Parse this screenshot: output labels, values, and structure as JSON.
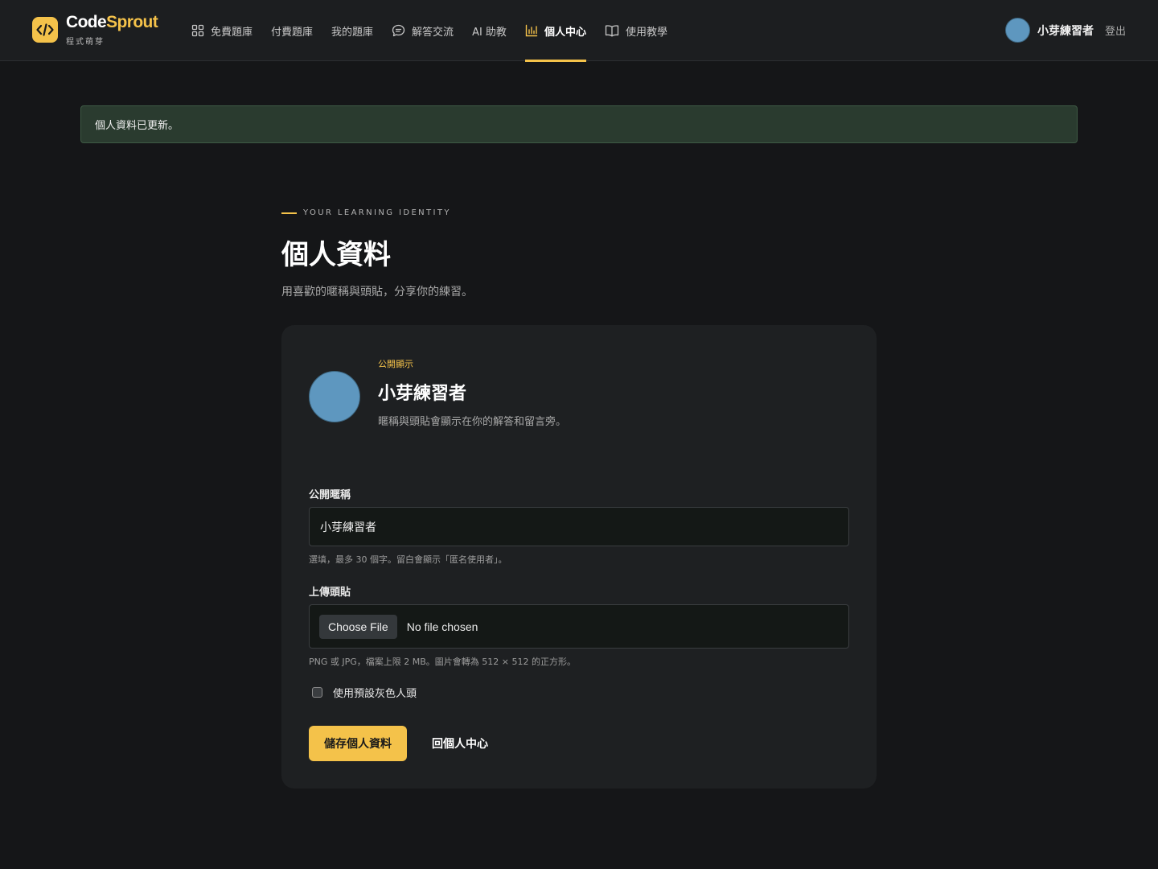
{
  "brand": {
    "name_main": "Code",
    "name_accent": "Sprout",
    "subtitle": "程式萌芽",
    "logo_icon": "code-brackets-icon"
  },
  "nav": {
    "items": [
      {
        "label": "免費題庫",
        "icon": "grid-icon",
        "active": false
      },
      {
        "label": "付費題庫",
        "icon": null,
        "active": false
      },
      {
        "label": "我的題庫",
        "icon": null,
        "active": false
      },
      {
        "label": "解答交流",
        "icon": "chat-icon",
        "active": false
      },
      {
        "label": "AI 助教",
        "icon": null,
        "active": false
      },
      {
        "label": "個人中心",
        "icon": "bar-chart-icon",
        "active": true
      },
      {
        "label": "使用教學",
        "icon": "book-icon",
        "active": false
      }
    ]
  },
  "user": {
    "name": "小芽練習者",
    "logout_label": "登出"
  },
  "flash": {
    "message": "個人資料已更新。"
  },
  "page": {
    "eyebrow": "YOUR LEARNING IDENTITY",
    "title": "個人資料",
    "subtitle": "用喜歡的暱稱與頭貼，分享你的練習。"
  },
  "profile_card": {
    "public_tag": "公開顯示",
    "display_name": "小芽練習者",
    "note": "暱稱與頭貼會顯示在你的解答和留言旁。"
  },
  "form": {
    "nickname_label": "公開暱稱",
    "nickname_value": "小芽練習者",
    "nickname_help": "選填，最多 30 個字。留白會顯示「匿名使用者」。",
    "avatar_label": "上傳頭貼",
    "file_button_label": "Choose File",
    "file_status": "No file chosen",
    "avatar_help": "PNG 或 JPG，檔案上限 2 MB。圖片會轉為 512 × 512 的正方形。",
    "default_avatar_label": "使用預設灰色人頭",
    "default_avatar_checked": false,
    "save_label": "儲存個人資料",
    "back_label": "回個人中心"
  },
  "colors": {
    "accent": "#f4c24a",
    "avatar": "#5e97bf",
    "flash_bg": "#2a3b2f"
  }
}
